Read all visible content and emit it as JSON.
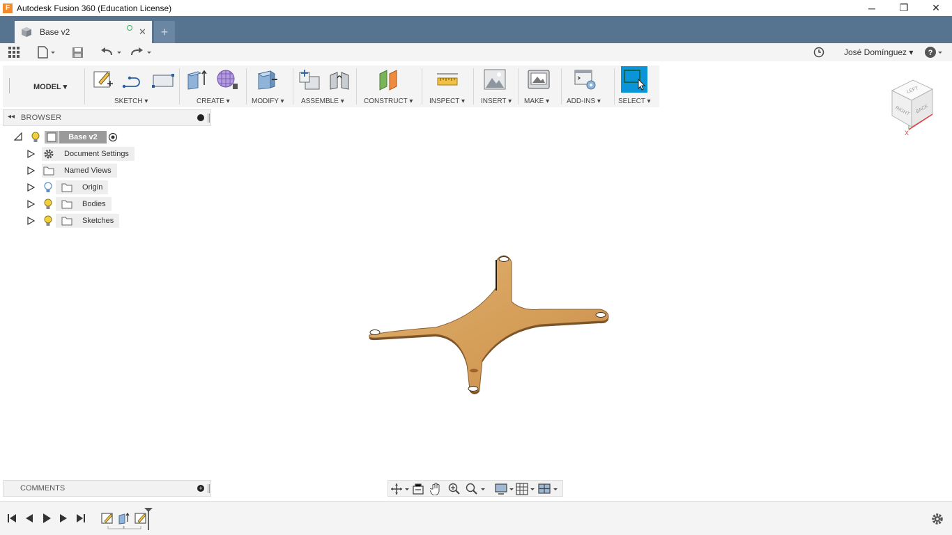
{
  "window": {
    "app_logo": "F",
    "title": "Autodesk Fusion 360 (Education License)",
    "minimize": "─",
    "maximize": "❐",
    "close": "✕"
  },
  "tabs": [
    {
      "label": "Base v2",
      "close": "✕"
    }
  ],
  "new_tab": "+",
  "user": {
    "name": "José Domínguez ▾"
  },
  "ribbon": {
    "workspace": "MODEL ▾",
    "groups": {
      "sketch": "SKETCH ▾",
      "create": "CREATE ▾",
      "modify": "MODIFY ▾",
      "assemble": "ASSEMBLE ▾",
      "construct": "CONSTRUCT ▾",
      "inspect": "INSPECT ▾",
      "insert": "INSERT ▾",
      "make": "MAKE ▾",
      "addins": "ADD-INS ▾",
      "select": "SELECT ▾"
    }
  },
  "browser": {
    "title": "BROWSER",
    "root": "Base v2",
    "items": [
      {
        "label": "Document Settings",
        "icon": "gear-icon"
      },
      {
        "label": "Named Views",
        "icon": "folder-icon"
      },
      {
        "label": "Origin",
        "icon": "folder-icon"
      },
      {
        "label": "Bodies",
        "icon": "folder-icon"
      },
      {
        "label": "Sketches",
        "icon": "folder-icon"
      }
    ]
  },
  "viewcube": {
    "top": "LEFT",
    "right": "BACK",
    "left": "RIGHT",
    "axis_x": "X"
  },
  "comments": {
    "title": "COMMENTS"
  },
  "colors": {
    "tabbar": "#56738f",
    "select_active": "#0b95d9",
    "wood": "#d9a460"
  }
}
